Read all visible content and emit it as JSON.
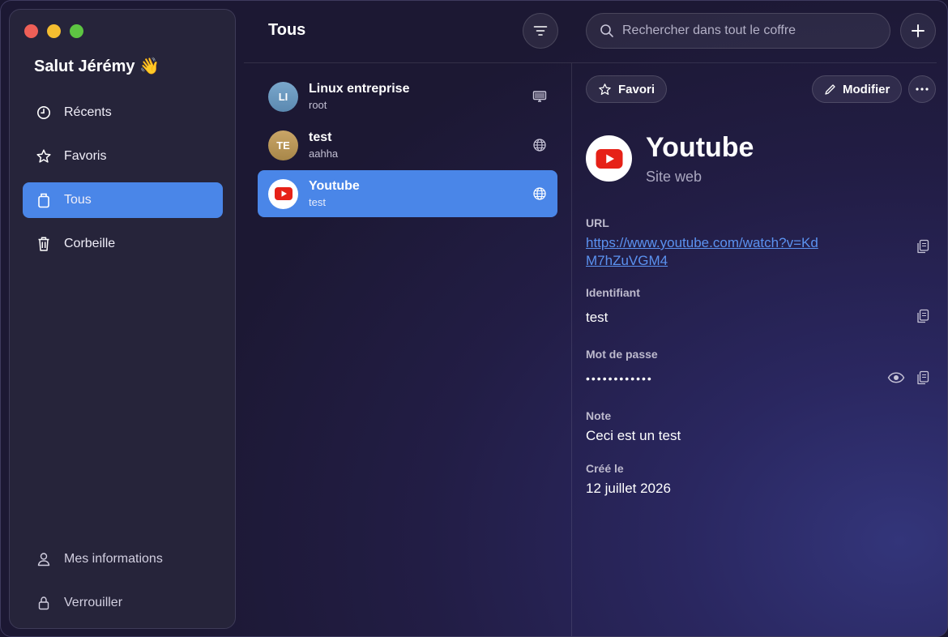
{
  "sidebar": {
    "greeting": "Salut Jérémy 👋",
    "items": [
      {
        "label": "Récents",
        "icon": "clock-icon"
      },
      {
        "label": "Favoris",
        "icon": "star-icon"
      },
      {
        "label": "Tous",
        "icon": "box-icon",
        "active": true
      },
      {
        "label": "Corbeille",
        "icon": "trash-icon"
      }
    ],
    "bottom": [
      {
        "label": "Mes informations",
        "icon": "user-icon"
      },
      {
        "label": "Verrouiller",
        "icon": "lock-icon"
      }
    ]
  },
  "header": {
    "list_title": "Tous",
    "search_placeholder": "Rechercher dans tout le coffre"
  },
  "items": [
    {
      "initials": "LI",
      "title": "Linux entreprise",
      "subtitle": "root",
      "type_icon": "monitor-icon"
    },
    {
      "initials": "TE",
      "title": "test",
      "subtitle": "aahha",
      "type_icon": "globe-icon"
    },
    {
      "initials": "",
      "title": "Youtube",
      "subtitle": "test",
      "type_icon": "globe-icon",
      "active": true
    }
  ],
  "detail": {
    "favorite_label": "Favori",
    "edit_label": "Modifier",
    "title": "Youtube",
    "type": "Site web",
    "url_label": "URL",
    "url_value": "https://www.youtube.com/watch?v=KdM7hZuVGM4",
    "username_label": "Identifiant",
    "username_value": "test",
    "password_label": "Mot de passe",
    "password_mask": "••••••••••••",
    "note_label": "Note",
    "note_value": "Ceci est un test",
    "created_label": "Créé le",
    "created_value": "12 juillet 2026"
  },
  "colors": {
    "accent": "#4a86e8",
    "link": "#5b92f0",
    "youtube_red": "#e62117"
  }
}
